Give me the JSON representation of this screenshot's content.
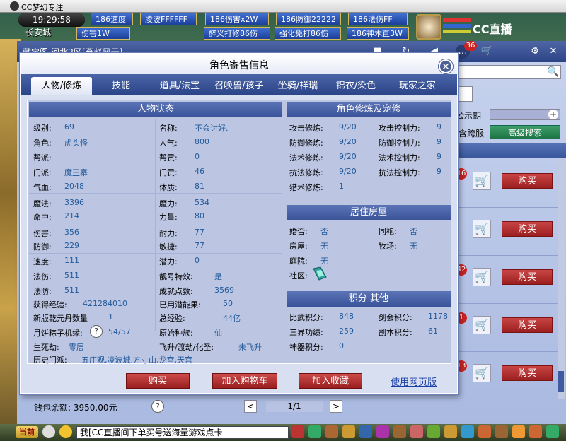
{
  "window": {
    "title": "CC梦幻专注"
  },
  "hud": {
    "clock": "19:29:58",
    "location": "长安城",
    "buffs": [
      "186速度",
      "凌波FFFFFF",
      "186伤害x2W",
      "186防御22222",
      "186法伤FF",
      "伤害1W",
      "醉义打修86伤",
      "强化免打86伤",
      "186神木直3W"
    ],
    "cc_logo": "CC直播",
    "notif_count": "36"
  },
  "shop": {
    "header_title": "藏宝阁-河北2区[燕赵风云]",
    "announce_label": "公示期",
    "cross_server_label": "含跨服",
    "advanced_search": "高级搜索",
    "row_badges": [
      "16",
      "42",
      "1",
      "13"
    ],
    "buy_label": "购买",
    "wallet_label": "钱包余额:",
    "wallet_value": "3950.00元",
    "pager": "1/1"
  },
  "modal": {
    "title": "角色寄售信息",
    "tabs": [
      "人物/修炼",
      "技能",
      "道具/法宝",
      "召唤兽/孩子",
      "坐骑/祥瑞",
      "锦衣/染色",
      "玩家之家"
    ],
    "sections": {
      "status": "人物状态",
      "cultivation": "角色修炼及宠修",
      "house": "居住房屋",
      "points": "积分 其他"
    },
    "status_left": [
      {
        "label": "级别:",
        "value": "69"
      },
      {
        "label": "角色:",
        "value": "虎头怪"
      },
      {
        "label": "帮派:",
        "value": ""
      },
      {
        "label": "门派:",
        "value": "魔王寨"
      },
      {
        "label": "气血:",
        "value": "2048"
      },
      {
        "label": "魔法:",
        "value": "3396"
      },
      {
        "label": "命中:",
        "value": "214"
      },
      {
        "label": "伤害:",
        "value": "356"
      },
      {
        "label": "防御:",
        "value": "229"
      },
      {
        "label": "速度:",
        "value": "111"
      },
      {
        "label": "法伤:",
        "value": "511"
      },
      {
        "label": "法防:",
        "value": "511"
      }
    ],
    "status_right": [
      {
        "label": "名称:",
        "value": "不会讨好."
      },
      {
        "label": "人气:",
        "value": "800"
      },
      {
        "label": "帮贡:",
        "value": "0"
      },
      {
        "label": "门贡:",
        "value": "46"
      },
      {
        "label": "体质:",
        "value": "81"
      },
      {
        "label": "魔力:",
        "value": "534"
      },
      {
        "label": "力量:",
        "value": "80"
      },
      {
        "label": "耐力:",
        "value": "77"
      },
      {
        "label": "敏捷:",
        "value": "77"
      },
      {
        "label": "潜力:",
        "value": "0"
      },
      {
        "label": "靓号特效:",
        "value": "是"
      },
      {
        "label": "成就点数:",
        "value": "3569"
      }
    ],
    "status_extra": {
      "exp_label": "获得经验:",
      "exp_value": "421284010",
      "potential_label": "已用潜能果:",
      "potential_value": "50",
      "qianyuan_label": "新版乾元丹数量",
      "qianyuan_value": "1",
      "total_exp_label": "总经验:",
      "total_exp_value": "44亿",
      "mooncake_label": "月饼粽子机缘:",
      "mooncake_value": "54/57",
      "race_label": "原始种族:",
      "race_value": "仙",
      "life_label": "生死劫:",
      "life_value": "零层",
      "fly_label": "飞升/渡劫/化圣:",
      "fly_value": "未飞升",
      "history_label": "历史门派:",
      "history_value": "五庄观,凌波城,方寸山,龙宫,天宫"
    },
    "cultivation_left": [
      {
        "label": "攻击修炼:",
        "value": "9/20"
      },
      {
        "label": "防御修炼:",
        "value": "9/20"
      },
      {
        "label": "法术修炼:",
        "value": "9/20"
      },
      {
        "label": "抗法修炼:",
        "value": "9/20"
      },
      {
        "label": "猎术修炼:",
        "value": "1"
      }
    ],
    "cultivation_right": [
      {
        "label": "攻击控制力:",
        "value": "9"
      },
      {
        "label": "防御控制力:",
        "value": "9"
      },
      {
        "label": "法术控制力:",
        "value": "9"
      },
      {
        "label": "抗法控制力:",
        "value": "9"
      }
    ],
    "house": {
      "marry_label": "婚否:",
      "marry_value": "否",
      "robe_label": "同袍:",
      "robe_value": "否",
      "house_label": "房屋:",
      "house_value": "无",
      "pasture_label": "牧场:",
      "pasture_value": "无",
      "yard_label": "庭院:",
      "yard_value": "无",
      "community_label": "社区:"
    },
    "points": {
      "pk_label": "比武积分:",
      "pk_value": "848",
      "jianhui_label": "剑会积分:",
      "jianhui_value": "1178",
      "sanjie_label": "三界功绩:",
      "sanjie_value": "259",
      "fuben_label": "副本积分:",
      "fuben_value": "61",
      "shenqi_label": "神器积分:",
      "shenqi_value": "0"
    },
    "buttons": {
      "buy": "购买",
      "add_cart": "加入购物车",
      "add_fav": "加入收藏",
      "web_version": "使用网页版"
    }
  },
  "taskbar": {
    "front": "当前",
    "chat": "我[CC直播间下单买号送海量游戏点卡"
  }
}
